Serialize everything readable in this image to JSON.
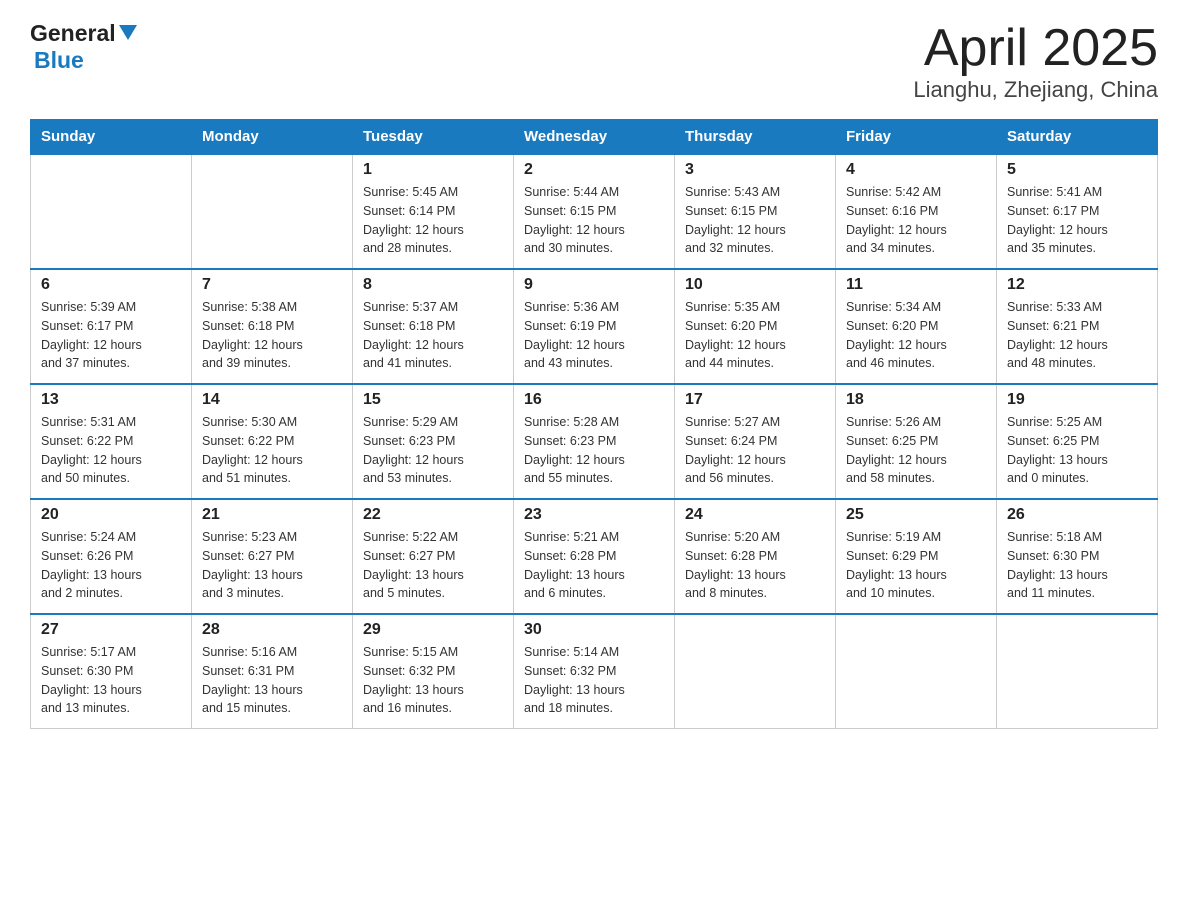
{
  "header": {
    "logo_general": "General",
    "logo_blue": "Blue",
    "title": "April 2025",
    "subtitle": "Lianghu, Zhejiang, China"
  },
  "days_of_week": [
    "Sunday",
    "Monday",
    "Tuesday",
    "Wednesday",
    "Thursday",
    "Friday",
    "Saturday"
  ],
  "weeks": [
    [
      {
        "day": "",
        "info": ""
      },
      {
        "day": "",
        "info": ""
      },
      {
        "day": "1",
        "info": "Sunrise: 5:45 AM\nSunset: 6:14 PM\nDaylight: 12 hours\nand 28 minutes."
      },
      {
        "day": "2",
        "info": "Sunrise: 5:44 AM\nSunset: 6:15 PM\nDaylight: 12 hours\nand 30 minutes."
      },
      {
        "day": "3",
        "info": "Sunrise: 5:43 AM\nSunset: 6:15 PM\nDaylight: 12 hours\nand 32 minutes."
      },
      {
        "day": "4",
        "info": "Sunrise: 5:42 AM\nSunset: 6:16 PM\nDaylight: 12 hours\nand 34 minutes."
      },
      {
        "day": "5",
        "info": "Sunrise: 5:41 AM\nSunset: 6:17 PM\nDaylight: 12 hours\nand 35 minutes."
      }
    ],
    [
      {
        "day": "6",
        "info": "Sunrise: 5:39 AM\nSunset: 6:17 PM\nDaylight: 12 hours\nand 37 minutes."
      },
      {
        "day": "7",
        "info": "Sunrise: 5:38 AM\nSunset: 6:18 PM\nDaylight: 12 hours\nand 39 minutes."
      },
      {
        "day": "8",
        "info": "Sunrise: 5:37 AM\nSunset: 6:18 PM\nDaylight: 12 hours\nand 41 minutes."
      },
      {
        "day": "9",
        "info": "Sunrise: 5:36 AM\nSunset: 6:19 PM\nDaylight: 12 hours\nand 43 minutes."
      },
      {
        "day": "10",
        "info": "Sunrise: 5:35 AM\nSunset: 6:20 PM\nDaylight: 12 hours\nand 44 minutes."
      },
      {
        "day": "11",
        "info": "Sunrise: 5:34 AM\nSunset: 6:20 PM\nDaylight: 12 hours\nand 46 minutes."
      },
      {
        "day": "12",
        "info": "Sunrise: 5:33 AM\nSunset: 6:21 PM\nDaylight: 12 hours\nand 48 minutes."
      }
    ],
    [
      {
        "day": "13",
        "info": "Sunrise: 5:31 AM\nSunset: 6:22 PM\nDaylight: 12 hours\nand 50 minutes."
      },
      {
        "day": "14",
        "info": "Sunrise: 5:30 AM\nSunset: 6:22 PM\nDaylight: 12 hours\nand 51 minutes."
      },
      {
        "day": "15",
        "info": "Sunrise: 5:29 AM\nSunset: 6:23 PM\nDaylight: 12 hours\nand 53 minutes."
      },
      {
        "day": "16",
        "info": "Sunrise: 5:28 AM\nSunset: 6:23 PM\nDaylight: 12 hours\nand 55 minutes."
      },
      {
        "day": "17",
        "info": "Sunrise: 5:27 AM\nSunset: 6:24 PM\nDaylight: 12 hours\nand 56 minutes."
      },
      {
        "day": "18",
        "info": "Sunrise: 5:26 AM\nSunset: 6:25 PM\nDaylight: 12 hours\nand 58 minutes."
      },
      {
        "day": "19",
        "info": "Sunrise: 5:25 AM\nSunset: 6:25 PM\nDaylight: 13 hours\nand 0 minutes."
      }
    ],
    [
      {
        "day": "20",
        "info": "Sunrise: 5:24 AM\nSunset: 6:26 PM\nDaylight: 13 hours\nand 2 minutes."
      },
      {
        "day": "21",
        "info": "Sunrise: 5:23 AM\nSunset: 6:27 PM\nDaylight: 13 hours\nand 3 minutes."
      },
      {
        "day": "22",
        "info": "Sunrise: 5:22 AM\nSunset: 6:27 PM\nDaylight: 13 hours\nand 5 minutes."
      },
      {
        "day": "23",
        "info": "Sunrise: 5:21 AM\nSunset: 6:28 PM\nDaylight: 13 hours\nand 6 minutes."
      },
      {
        "day": "24",
        "info": "Sunrise: 5:20 AM\nSunset: 6:28 PM\nDaylight: 13 hours\nand 8 minutes."
      },
      {
        "day": "25",
        "info": "Sunrise: 5:19 AM\nSunset: 6:29 PM\nDaylight: 13 hours\nand 10 minutes."
      },
      {
        "day": "26",
        "info": "Sunrise: 5:18 AM\nSunset: 6:30 PM\nDaylight: 13 hours\nand 11 minutes."
      }
    ],
    [
      {
        "day": "27",
        "info": "Sunrise: 5:17 AM\nSunset: 6:30 PM\nDaylight: 13 hours\nand 13 minutes."
      },
      {
        "day": "28",
        "info": "Sunrise: 5:16 AM\nSunset: 6:31 PM\nDaylight: 13 hours\nand 15 minutes."
      },
      {
        "day": "29",
        "info": "Sunrise: 5:15 AM\nSunset: 6:32 PM\nDaylight: 13 hours\nand 16 minutes."
      },
      {
        "day": "30",
        "info": "Sunrise: 5:14 AM\nSunset: 6:32 PM\nDaylight: 13 hours\nand 18 minutes."
      },
      {
        "day": "",
        "info": ""
      },
      {
        "day": "",
        "info": ""
      },
      {
        "day": "",
        "info": ""
      }
    ]
  ]
}
